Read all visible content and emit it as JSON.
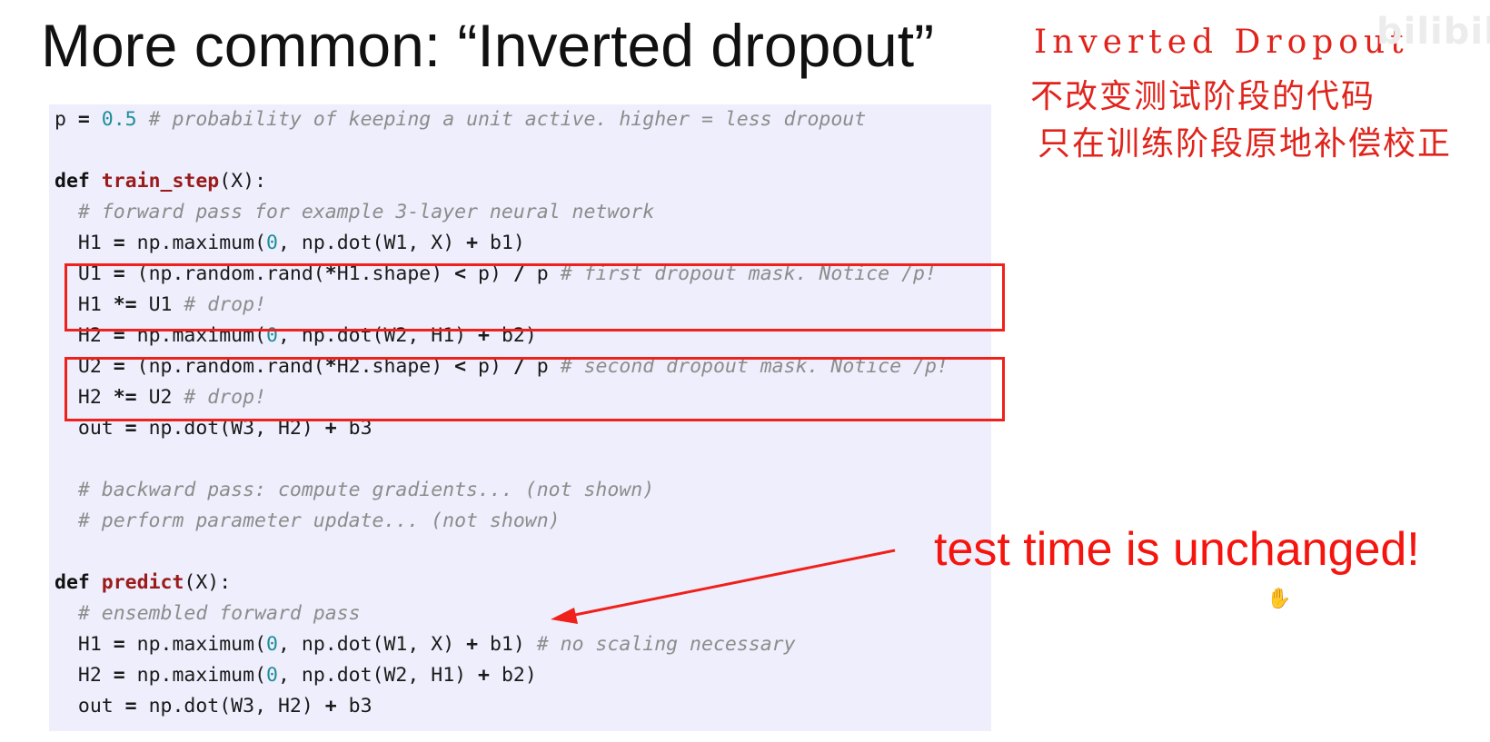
{
  "slide": {
    "title": "More common: “Inverted dropout”"
  },
  "code": {
    "lines": [
      {
        "tokens": [
          {
            "t": "p ",
            "c": "plain"
          },
          {
            "t": "=",
            "c": "op"
          },
          {
            "t": " ",
            "c": "plain"
          },
          {
            "t": "0.5",
            "c": "num"
          },
          {
            "t": " ",
            "c": "plain"
          },
          {
            "t": "# probability of keeping a unit active. higher = less dropout",
            "c": "cmt"
          }
        ]
      },
      {
        "tokens": []
      },
      {
        "tokens": [
          {
            "t": "def",
            "c": "kw"
          },
          {
            "t": " ",
            "c": "plain"
          },
          {
            "t": "train_step",
            "c": "fn"
          },
          {
            "t": "(X):",
            "c": "plain"
          }
        ]
      },
      {
        "tokens": [
          {
            "t": "  ",
            "c": "plain"
          },
          {
            "t": "# forward pass for example 3-layer neural network",
            "c": "cmt"
          }
        ]
      },
      {
        "tokens": [
          {
            "t": "  H1 ",
            "c": "plain"
          },
          {
            "t": "=",
            "c": "op"
          },
          {
            "t": " np.maximum(",
            "c": "plain"
          },
          {
            "t": "0",
            "c": "num"
          },
          {
            "t": ", np.dot(W1, X) ",
            "c": "plain"
          },
          {
            "t": "+",
            "c": "op"
          },
          {
            "t": " b1)",
            "c": "plain"
          }
        ]
      },
      {
        "tokens": [
          {
            "t": "  U1 ",
            "c": "plain"
          },
          {
            "t": "=",
            "c": "op"
          },
          {
            "t": " (np.random.rand(",
            "c": "plain"
          },
          {
            "t": "*",
            "c": "op"
          },
          {
            "t": "H1.shape) ",
            "c": "plain"
          },
          {
            "t": "<",
            "c": "op"
          },
          {
            "t": " p) ",
            "c": "plain"
          },
          {
            "t": "/",
            "c": "op"
          },
          {
            "t": " p ",
            "c": "plain"
          },
          {
            "t": "# first dropout mask. Notice /p!",
            "c": "cmt"
          }
        ]
      },
      {
        "tokens": [
          {
            "t": "  H1 ",
            "c": "plain"
          },
          {
            "t": "*=",
            "c": "op"
          },
          {
            "t": " U1 ",
            "c": "plain"
          },
          {
            "t": "# drop!",
            "c": "cmt"
          }
        ]
      },
      {
        "tokens": [
          {
            "t": "  H2 ",
            "c": "plain"
          },
          {
            "t": "=",
            "c": "op"
          },
          {
            "t": " np.maximum(",
            "c": "plain"
          },
          {
            "t": "0",
            "c": "num"
          },
          {
            "t": ", np.dot(W2, H1) ",
            "c": "plain"
          },
          {
            "t": "+",
            "c": "op"
          },
          {
            "t": " b2)",
            "c": "plain"
          }
        ]
      },
      {
        "tokens": [
          {
            "t": "  U2 ",
            "c": "plain"
          },
          {
            "t": "=",
            "c": "op"
          },
          {
            "t": " (np.random.rand(",
            "c": "plain"
          },
          {
            "t": "*",
            "c": "op"
          },
          {
            "t": "H2.shape) ",
            "c": "plain"
          },
          {
            "t": "<",
            "c": "op"
          },
          {
            "t": " p) ",
            "c": "plain"
          },
          {
            "t": "/",
            "c": "op"
          },
          {
            "t": " p ",
            "c": "plain"
          },
          {
            "t": "# second dropout mask. Notice /p!",
            "c": "cmt"
          }
        ]
      },
      {
        "tokens": [
          {
            "t": "  H2 ",
            "c": "plain"
          },
          {
            "t": "*=",
            "c": "op"
          },
          {
            "t": " U2 ",
            "c": "plain"
          },
          {
            "t": "# drop!",
            "c": "cmt"
          }
        ]
      },
      {
        "tokens": [
          {
            "t": "  out ",
            "c": "plain"
          },
          {
            "t": "=",
            "c": "op"
          },
          {
            "t": " np.dot(W3, H2) ",
            "c": "plain"
          },
          {
            "t": "+",
            "c": "op"
          },
          {
            "t": " b3",
            "c": "plain"
          }
        ]
      },
      {
        "tokens": []
      },
      {
        "tokens": [
          {
            "t": "  ",
            "c": "plain"
          },
          {
            "t": "# backward pass: compute gradients... (not shown)",
            "c": "cmt"
          }
        ]
      },
      {
        "tokens": [
          {
            "t": "  ",
            "c": "plain"
          },
          {
            "t": "# perform parameter update... (not shown)",
            "c": "cmt"
          }
        ]
      },
      {
        "tokens": []
      },
      {
        "tokens": [
          {
            "t": "def",
            "c": "kw"
          },
          {
            "t": " ",
            "c": "plain"
          },
          {
            "t": "predict",
            "c": "fn"
          },
          {
            "t": "(X):",
            "c": "plain"
          }
        ]
      },
      {
        "tokens": [
          {
            "t": "  ",
            "c": "plain"
          },
          {
            "t": "# ensembled forward pass",
            "c": "cmt"
          }
        ]
      },
      {
        "tokens": [
          {
            "t": "  H1 ",
            "c": "plain"
          },
          {
            "t": "=",
            "c": "op"
          },
          {
            "t": " np.maximum(",
            "c": "plain"
          },
          {
            "t": "0",
            "c": "num"
          },
          {
            "t": ", np.dot(W1, X) ",
            "c": "plain"
          },
          {
            "t": "+",
            "c": "op"
          },
          {
            "t": " b1) ",
            "c": "plain"
          },
          {
            "t": "# no scaling necessary",
            "c": "cmt"
          }
        ]
      },
      {
        "tokens": [
          {
            "t": "  H2 ",
            "c": "plain"
          },
          {
            "t": "=",
            "c": "op"
          },
          {
            "t": " np.maximum(",
            "c": "plain"
          },
          {
            "t": "0",
            "c": "num"
          },
          {
            "t": ", np.dot(W2, H1) ",
            "c": "plain"
          },
          {
            "t": "+",
            "c": "op"
          },
          {
            "t": " b2)",
            "c": "plain"
          }
        ]
      },
      {
        "tokens": [
          {
            "t": "  out ",
            "c": "plain"
          },
          {
            "t": "=",
            "c": "op"
          },
          {
            "t": " np.dot(W3, H2) ",
            "c": "plain"
          },
          {
            "t": "+",
            "c": "op"
          },
          {
            "t": " b3",
            "c": "plain"
          }
        ]
      }
    ]
  },
  "annotations": {
    "line1": "Inverted Dropout",
    "line2": "不改变测试阶段的代码",
    "line3": "只在训练阶段原地补偿校正"
  },
  "callout": {
    "text": "test time is unchanged!"
  },
  "watermark": {
    "text": "bilibili"
  },
  "cursor": {
    "icon": "hand-cursor-icon",
    "glyph": "✋"
  },
  "colors": {
    "code_background": "#eeeefc",
    "annotation_red": "#e0241c",
    "callout_red": "#f5140e",
    "box_red": "#f0201a",
    "function_name": "#9b1b1b",
    "number": "#1e8e99",
    "comment": "#8c8c8c"
  }
}
